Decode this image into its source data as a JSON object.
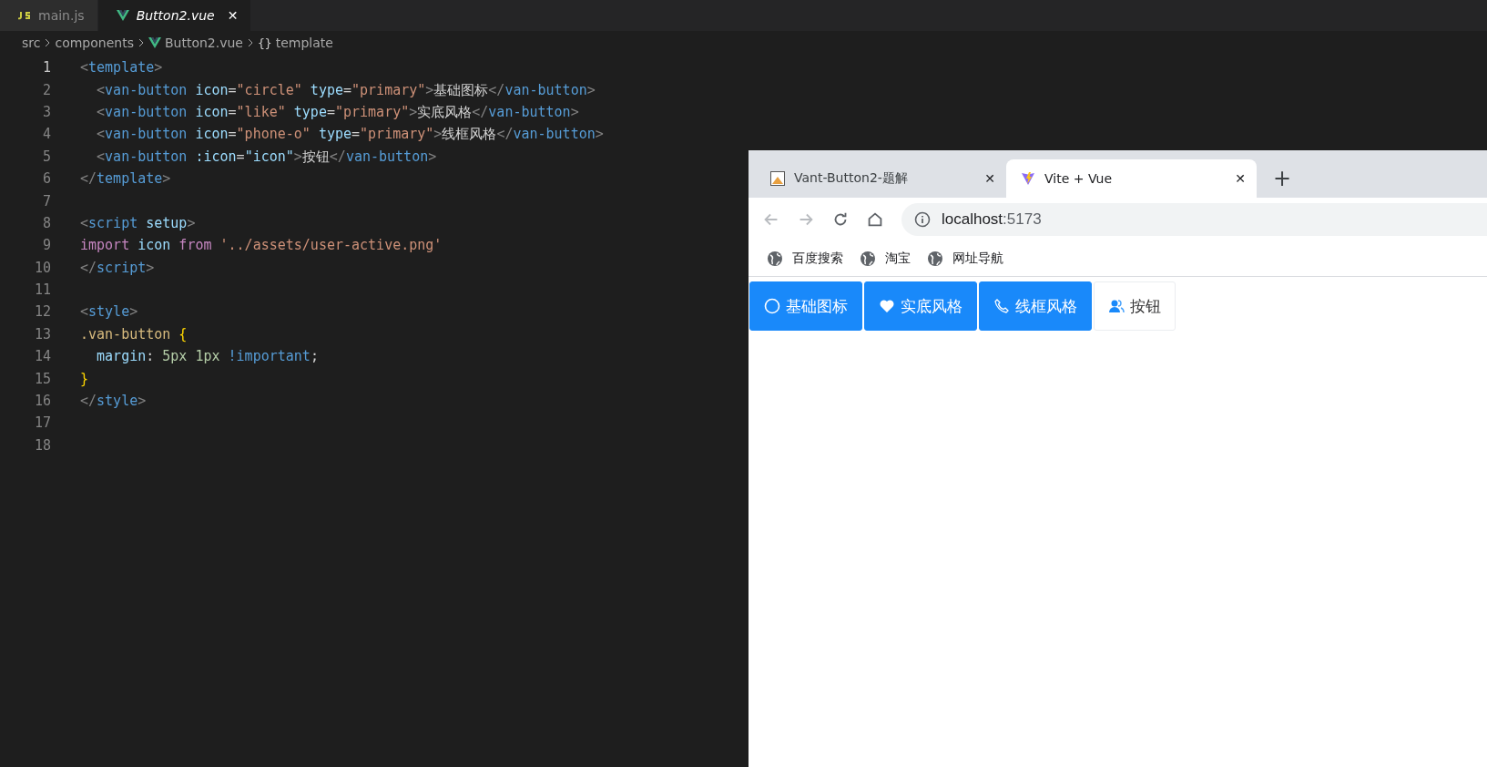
{
  "editor": {
    "tabs": [
      {
        "label": "main.js",
        "selected": false
      },
      {
        "label": "Button2.vue",
        "selected": true,
        "close": "✕"
      }
    ],
    "breadcrumbs": [
      {
        "label": "src"
      },
      {
        "label": "components"
      },
      {
        "label": "Button2.vue"
      },
      {
        "symbol": "{}",
        "label": "template"
      }
    ],
    "lines": [
      {
        "number": "1",
        "current": true,
        "tokens": [
          {
            "kind": "punct",
            "text": "<"
          },
          {
            "kind": "tag",
            "text": "template"
          },
          {
            "kind": "punct",
            "text": ">"
          }
        ]
      },
      {
        "number": "2",
        "current": false,
        "tokens": [
          {
            "kind": "punct",
            "text": "  <"
          },
          {
            "kind": "tag",
            "text": "van-button"
          },
          {
            "kind": "attr",
            "text": " icon"
          },
          {
            "kind": "plain",
            "text": "="
          },
          {
            "kind": "string",
            "text": "\"circle\""
          },
          {
            "kind": "attr",
            "text": " type"
          },
          {
            "kind": "plain",
            "text": "="
          },
          {
            "kind": "string",
            "text": "\"primary\""
          },
          {
            "kind": "punct",
            "text": ">"
          },
          {
            "kind": "plain",
            "text": "基础图标"
          },
          {
            "kind": "punct",
            "text": "</"
          },
          {
            "kind": "tag",
            "text": "van-button"
          },
          {
            "kind": "punct",
            "text": ">"
          }
        ]
      },
      {
        "number": "3",
        "current": false,
        "tokens": [
          {
            "kind": "punct",
            "text": "  <"
          },
          {
            "kind": "tag",
            "text": "van-button"
          },
          {
            "kind": "attr",
            "text": " icon"
          },
          {
            "kind": "plain",
            "text": "="
          },
          {
            "kind": "string",
            "text": "\"like\""
          },
          {
            "kind": "attr",
            "text": " type"
          },
          {
            "kind": "plain",
            "text": "="
          },
          {
            "kind": "string",
            "text": "\"primary\""
          },
          {
            "kind": "punct",
            "text": ">"
          },
          {
            "kind": "plain",
            "text": "实底风格"
          },
          {
            "kind": "punct",
            "text": "</"
          },
          {
            "kind": "tag",
            "text": "van-button"
          },
          {
            "kind": "punct",
            "text": ">"
          }
        ]
      },
      {
        "number": "4",
        "current": false,
        "tokens": [
          {
            "kind": "punct",
            "text": "  <"
          },
          {
            "kind": "tag",
            "text": "van-button"
          },
          {
            "kind": "attr",
            "text": " icon"
          },
          {
            "kind": "plain",
            "text": "="
          },
          {
            "kind": "string",
            "text": "\"phone-o\""
          },
          {
            "kind": "attr",
            "text": " type"
          },
          {
            "kind": "plain",
            "text": "="
          },
          {
            "kind": "string",
            "text": "\"primary\""
          },
          {
            "kind": "punct",
            "text": ">"
          },
          {
            "kind": "plain",
            "text": "线框风格"
          },
          {
            "kind": "punct",
            "text": "</"
          },
          {
            "kind": "tag",
            "text": "van-button"
          },
          {
            "kind": "punct",
            "text": ">"
          }
        ]
      },
      {
        "number": "5",
        "current": false,
        "tokens": [
          {
            "kind": "punct",
            "text": "  <"
          },
          {
            "kind": "tag",
            "text": "van-button"
          },
          {
            "kind": "attr",
            "text": " :icon"
          },
          {
            "kind": "plain",
            "text": "="
          },
          {
            "kind": "attr",
            "text": "\"icon\""
          },
          {
            "kind": "punct",
            "text": ">"
          },
          {
            "kind": "plain",
            "text": "按钮"
          },
          {
            "kind": "punct",
            "text": "</"
          },
          {
            "kind": "tag",
            "text": "van-button"
          },
          {
            "kind": "punct",
            "text": ">"
          }
        ]
      },
      {
        "number": "6",
        "current": false,
        "tokens": [
          {
            "kind": "punct",
            "text": "</"
          },
          {
            "kind": "tag",
            "text": "template"
          },
          {
            "kind": "punct",
            "text": ">"
          }
        ]
      },
      {
        "number": "7",
        "current": false
      },
      {
        "number": "8",
        "current": false,
        "tokens": [
          {
            "kind": "punct",
            "text": "<"
          },
          {
            "kind": "tag",
            "text": "script"
          },
          {
            "kind": "attr",
            "text": " setup"
          },
          {
            "kind": "punct",
            "text": ">"
          }
        ]
      },
      {
        "number": "9",
        "current": false,
        "tokens": [
          {
            "kind": "keyword",
            "text": "import"
          },
          {
            "kind": "attr",
            "text": " icon"
          },
          {
            "kind": "keyword",
            "text": " from"
          },
          {
            "kind": "string",
            "text": " '../assets/user-active.png'"
          }
        ]
      },
      {
        "number": "10",
        "current": false,
        "tokens": [
          {
            "kind": "punct",
            "text": "</"
          },
          {
            "kind": "tag",
            "text": "script"
          },
          {
            "kind": "punct",
            "text": ">"
          }
        ]
      },
      {
        "number": "11",
        "current": false
      },
      {
        "number": "12",
        "current": false,
        "tokens": [
          {
            "kind": "punct",
            "text": "<"
          },
          {
            "kind": "tag",
            "text": "style"
          },
          {
            "kind": "punct",
            "text": ">"
          }
        ]
      },
      {
        "number": "13",
        "current": false,
        "tokens": [
          {
            "kind": "selector",
            "text": ".van-button"
          },
          {
            "kind": "brace",
            "text": " {"
          }
        ]
      },
      {
        "number": "14",
        "current": false,
        "tokens": [
          {
            "kind": "attr",
            "text": "  margin"
          },
          {
            "kind": "plain",
            "text": ":"
          },
          {
            "kind": "number",
            "text": " 5px 1px"
          },
          {
            "kind": "tag",
            "text": " !important"
          },
          {
            "kind": "plain",
            "text": ";"
          }
        ]
      },
      {
        "number": "15",
        "current": false,
        "tokens": [
          {
            "kind": "brace",
            "text": "}"
          }
        ]
      },
      {
        "number": "16",
        "current": false,
        "tokens": [
          {
            "kind": "punct",
            "text": "</"
          },
          {
            "kind": "tag",
            "text": "style"
          },
          {
            "kind": "punct",
            "text": ">"
          }
        ]
      },
      {
        "number": "17",
        "current": false
      },
      {
        "number": "18",
        "current": false
      }
    ]
  },
  "browser": {
    "tabs": [
      {
        "title": "Vant-Button2-题解",
        "selected": false,
        "close": "✕"
      },
      {
        "title": "Vite + Vue",
        "selected": true,
        "close": "✕"
      }
    ],
    "new_tab": "+",
    "nav": [
      {
        "kind": "back",
        "disabled": true
      },
      {
        "kind": "forward",
        "disabled": true
      },
      {
        "kind": "reload",
        "disabled": false
      },
      {
        "kind": "home",
        "disabled": false
      }
    ],
    "address": {
      "host": "localhost",
      "port": ":5173"
    },
    "bookmarks": [
      {
        "label": "百度搜索"
      },
      {
        "label": "淘宝"
      },
      {
        "label": "网址导航"
      }
    ],
    "buttons": [
      {
        "label": "基础图标",
        "kind": "primary"
      },
      {
        "label": "实底风格",
        "kind": "primary"
      },
      {
        "label": "线框风格",
        "kind": "primary"
      },
      {
        "label": "按钮",
        "kind": "default"
      }
    ]
  }
}
